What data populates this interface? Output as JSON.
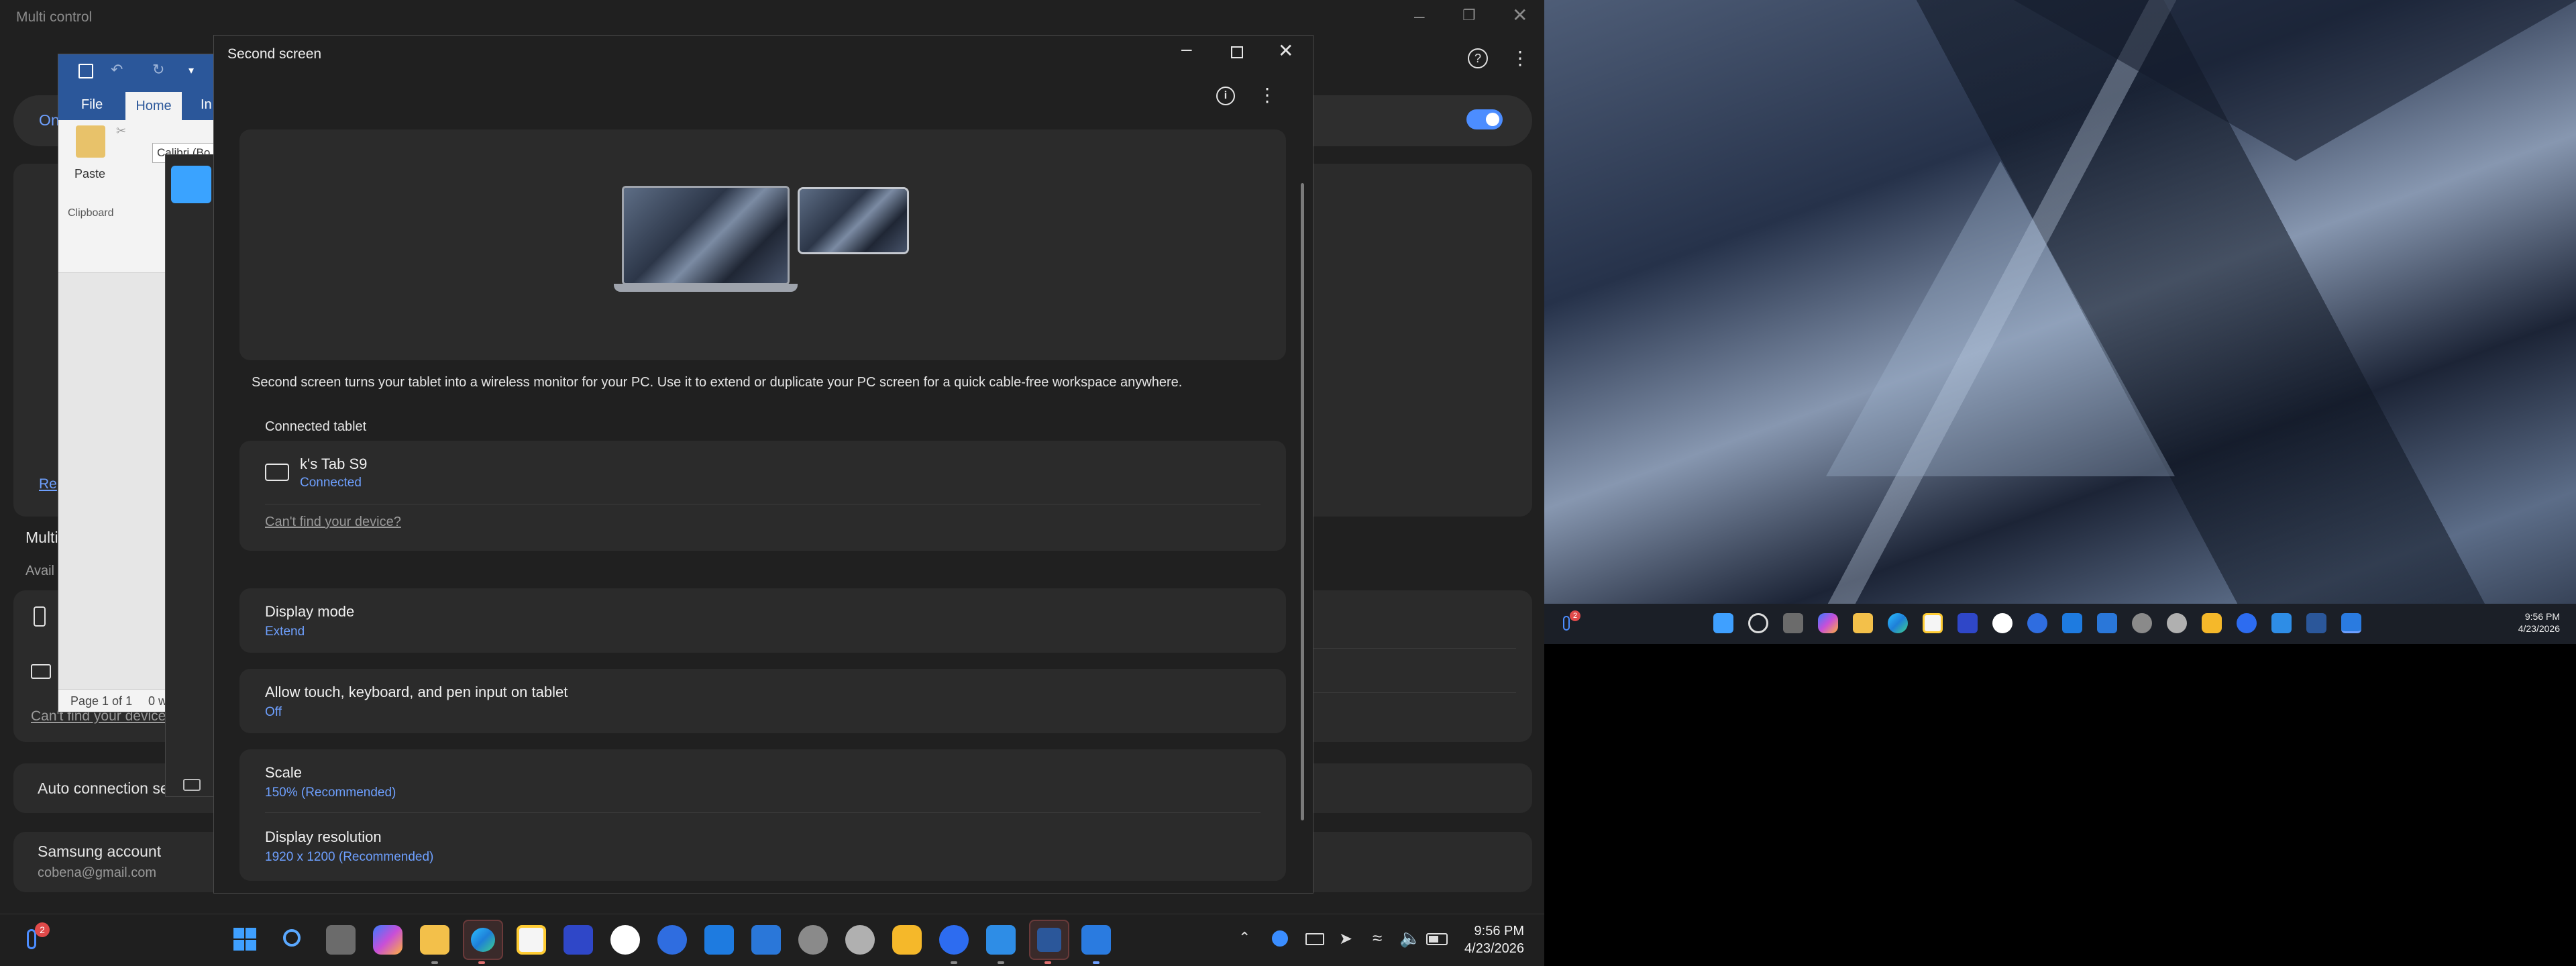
{
  "multi_control": {
    "title": "Multi control",
    "top_bar_label": "On",
    "reset_link": "Re",
    "section_label": "Multi",
    "available_label": "Avail",
    "cant_find": "Can't find your device",
    "auto_connection": "Auto connection se",
    "samsung_account_title": "Samsung account",
    "samsung_account_email": "cobena@gmail.com"
  },
  "word": {
    "tabs": {
      "file": "File",
      "home": "Home",
      "insert": "In"
    },
    "font_box": "Calibri (Bo",
    "paste_label": "Paste",
    "clipboard_label": "Clipboard",
    "status_page": "Page 1 of 1",
    "status_words": "0 w"
  },
  "second_screen": {
    "title": "Second screen",
    "description": "Second screen turns your tablet into a wireless monitor for your PC. Use it to extend or duplicate your PC screen for a quick cable-free workspace anywhere.",
    "connected_tablet_label": "Connected tablet",
    "tablet_name": "k's Tab S9",
    "tablet_status": "Connected",
    "cant_find": "Can't find your device?",
    "display_mode_title": "Display mode",
    "display_mode_value": "Extend",
    "touch_title": "Allow touch, keyboard, and pen input on tablet",
    "touch_value": "Off",
    "scale_title": "Scale",
    "scale_value": "150% (Recommended)",
    "resolution_title": "Display resolution",
    "resolution_value": "1920 x 1200 (Recommended)"
  },
  "taskbar_left": {
    "time": "9:56 PM",
    "date": "4/23/2026",
    "badge": "2"
  },
  "taskbar_right": {
    "time": "9:56 PM",
    "date": "4/23/2026",
    "badge": "2"
  },
  "colors": {
    "accent": "#4c8dff",
    "link_blue": "#6ea0ff",
    "word_blue": "#2b579a"
  }
}
